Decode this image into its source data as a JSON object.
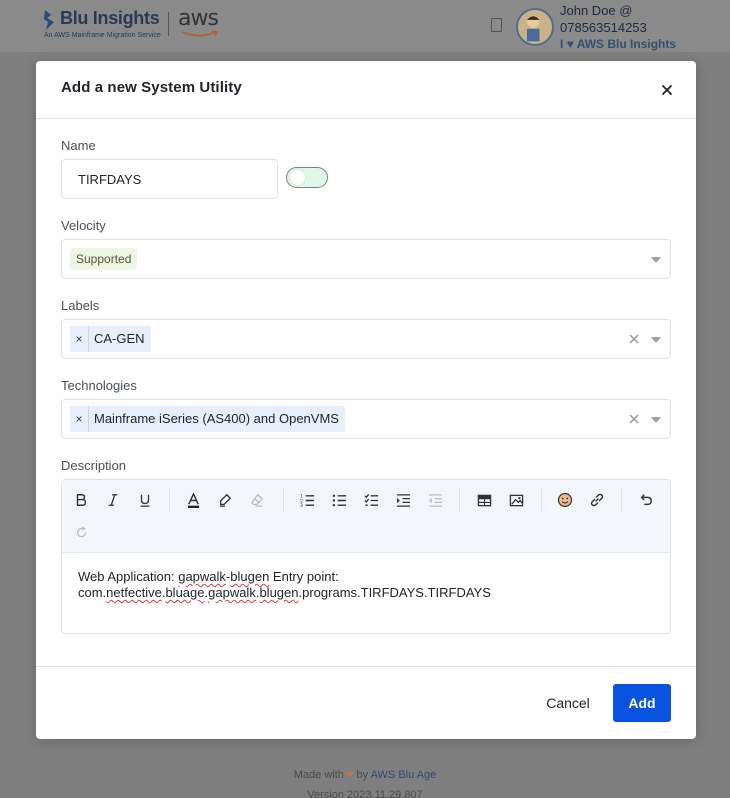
{
  "header": {
    "logo_title": "Blu Insights",
    "logo_subtitle": "An AWS Mainframe Migration Service",
    "aws_wordmark": "aws",
    "user_line1": "John Doe @",
    "user_line2": "078563514253",
    "love_prefix": "I",
    "love_text": "AWS Blu Insights"
  },
  "modal": {
    "title": "Add a new System Utility",
    "name": {
      "label": "Name",
      "value": "TIRFDAYS",
      "enabled": true
    },
    "velocity": {
      "label": "Velocity",
      "value": "Supported"
    },
    "labels": {
      "label": "Labels",
      "chips": [
        "CA-GEN"
      ]
    },
    "technologies": {
      "label": "Technologies",
      "chips": [
        "Mainframe iSeries (AS400) and OpenVMS"
      ]
    },
    "description": {
      "label": "Description",
      "toolbar_icons": [
        "bold-icon",
        "italic-icon",
        "underline-icon",
        "text-color-icon",
        "highlight-icon",
        "eraser-icon",
        "ordered-list-icon",
        "bullet-list-icon",
        "checklist-icon",
        "indent-icon",
        "outdent-icon",
        "table-icon",
        "image-icon",
        "emoji-icon",
        "link-icon",
        "undo-icon",
        "redo-icon"
      ],
      "parts": [
        "Web Application: ",
        "gapwalk",
        "-",
        "blugen",
        " Entry point: com.",
        "netfective",
        ".",
        "bluage",
        ".",
        "gapwalk",
        ".",
        "blugen",
        ".programs.TIRFDAYS.TIRFDAYS"
      ]
    },
    "cancel_label": "Cancel",
    "add_label": "Add"
  },
  "footer": {
    "made_with": "Made with",
    "by": "by",
    "brand": "AWS Blu Age",
    "version": "Version 2023.11.29.807"
  },
  "colors": {
    "primary": "#0a53e0",
    "overlay": "#7f7f7f",
    "chip_bg": "#e7f0fa",
    "badge_bg": "#eef6e2"
  }
}
